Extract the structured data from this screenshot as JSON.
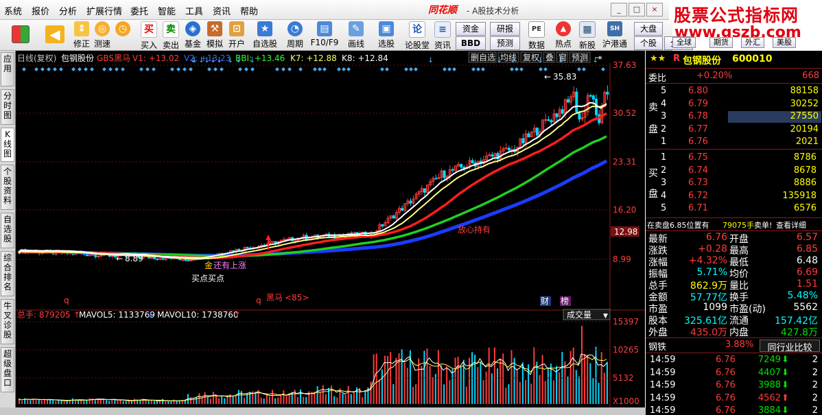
{
  "menu": [
    "系统",
    "报价",
    "分析",
    "扩展行情",
    "委托",
    "智能",
    "工具",
    "资讯",
    "帮助"
  ],
  "app": {
    "logo": "同花顺",
    "title": "- A股技术分析",
    "minimize": "_",
    "maximize": "□",
    "close": "×"
  },
  "watermark": {
    "line1": "股票公式指标网",
    "line2": "www.gszb.com"
  },
  "toolbar": {
    "buttons": [
      {
        "label": "",
        "icon": "layout-icon"
      },
      {
        "label": "",
        "icon": "back-arrow-icon"
      },
      {
        "label": "修正",
        "icon": "up-down-icon"
      },
      {
        "label": "测速",
        "icon": "speed-icon"
      },
      {
        "label": "",
        "icon": "clock-icon"
      },
      {
        "label": "买入",
        "icon": "buy-icon",
        "glyph": "买"
      },
      {
        "label": "卖出",
        "icon": "sell-icon",
        "glyph": "卖"
      },
      {
        "label": "基金",
        "icon": "fund-icon"
      },
      {
        "label": "模拟",
        "icon": "hammer-icon"
      },
      {
        "label": "开户",
        "icon": "lock-icon"
      },
      {
        "label": "自选股",
        "icon": "star-icon"
      },
      {
        "label": "周期",
        "icon": "period-icon"
      },
      {
        "label": "F10/F9",
        "icon": "f10-icon"
      },
      {
        "label": "画线",
        "icon": "pen-icon"
      },
      {
        "label": "选股",
        "icon": "select-icon"
      },
      {
        "label": "论股堂",
        "icon": "discuss-icon",
        "glyph": "论"
      },
      {
        "label": "资讯",
        "icon": "info-icon"
      },
      {
        "label": "数据",
        "icon": "data-icon",
        "glyph": "PE"
      },
      {
        "label": "热点",
        "icon": "hot-icon"
      },
      {
        "label": "新股",
        "icon": "newstock-icon"
      },
      {
        "label": "沪港通",
        "icon": "hk-icon"
      }
    ],
    "boxes": {
      "zijin": "资金",
      "yanbao": "研报",
      "bbd": "BBD",
      "yuce": "预测",
      "dapan": "大盘",
      "gegu": "个股",
      "quanqiu": "全球",
      "qihuo": "期货",
      "waihui": "外汇",
      "meiguo": "美股"
    }
  },
  "lefttabs": [
    "应用",
    "分时图",
    "K线图",
    "个股资料",
    "自选股",
    "综合排名",
    "牛叉诊股",
    "超级盘口"
  ],
  "chart": {
    "header": {
      "period": "日线(复权)",
      "stock": "包钢股份",
      "indicator": "GBS黑马",
      "v1": "V1: +13.02",
      "v2": "V2: +13.23",
      "bbi": "BBI: +13.46",
      "k7": "K7: +12.88",
      "k8": "K8: +12.84"
    },
    "topbuttons": [
      "删自选",
      "均线",
      "复权",
      "叠",
      "窗",
      "预测"
    ],
    "yticks": [
      "37.63",
      "30.52",
      "23.31",
      "16.20",
      "12.98",
      "8.99"
    ],
    "current_price": "12.98",
    "annotations": {
      "high": "35.83",
      "low": "8.89",
      "gold": "金",
      "gold_text": "还有上涨",
      "buy": "买点买点",
      "heima": "黑马",
      "heima_num": "<85>",
      "hold": "放心持有",
      "q": "q",
      "cai": "财",
      "bang": "榜"
    },
    "volume_header": {
      "total": "总手: 879205",
      "mavol5": "MAVOL5: 1133769",
      "mavol10": "MAVOL10: 1738760",
      "select": "成交量"
    },
    "vol_yticks": [
      "15397",
      "10265",
      "5132",
      "X1000"
    ]
  },
  "quote": {
    "stars": "★★",
    "flag": "R",
    "name": "包钢股份",
    "code": "600010",
    "weibi": {
      "label": "委比",
      "pct": "+0.20%",
      "val": "668"
    },
    "sell": [
      {
        "lvl": "5",
        "price": "6.80",
        "vol": "88158"
      },
      {
        "lvl": "4",
        "price": "6.79",
        "vol": "30252"
      },
      {
        "lvl": "3",
        "price": "6.78",
        "vol": "27550"
      },
      {
        "lvl": "2",
        "price": "6.77",
        "vol": "20194"
      },
      {
        "lvl": "1",
        "price": "6.76",
        "vol": "2021"
      }
    ],
    "buy": [
      {
        "lvl": "1",
        "price": "6.75",
        "vol": "8786"
      },
      {
        "lvl": "2",
        "price": "6.74",
        "vol": "8678"
      },
      {
        "lvl": "3",
        "price": "6.73",
        "vol": "8886"
      },
      {
        "lvl": "4",
        "price": "6.72",
        "vol": "135918"
      },
      {
        "lvl": "5",
        "price": "6.71",
        "vol": "6576"
      }
    ],
    "sell_label": [
      "卖",
      "盘"
    ],
    "buy_label": [
      "买",
      "盘"
    ],
    "status": {
      "text": "在卖盘6.85位置有",
      "num": "79075手",
      "action": "卖单!",
      "link": "查看详细"
    },
    "stats": [
      {
        "k1": "最新",
        "v1": "6.76",
        "c1": "red",
        "k2": "开盘",
        "v2": "6.57",
        "c2": "red"
      },
      {
        "k1": "涨跌",
        "v1": "+0.28",
        "c1": "red",
        "k2": "最高",
        "v2": "6.85",
        "c2": "red"
      },
      {
        "k1": "涨幅",
        "v1": "+4.32%",
        "c1": "red",
        "k2": "最低",
        "v2": "6.48",
        "c2": "wht"
      },
      {
        "k1": "振幅",
        "v1": "5.71%",
        "c1": "cyn",
        "k2": "均价",
        "v2": "6.69",
        "c2": "red"
      },
      {
        "k1": "总手",
        "v1": "862.9万",
        "c1": "yel",
        "k2": "量比",
        "v2": "1.51",
        "c2": "red"
      },
      {
        "k1": "金额",
        "v1": "57.77亿",
        "c1": "cyn",
        "k2": "换手",
        "v2": "5.48%",
        "c2": "cyn"
      },
      {
        "k1": "市盈",
        "v1": "1099",
        "c1": "wht",
        "k2": "市盈(动)",
        "v2": "5562",
        "c2": "wht"
      },
      {
        "k1": "股本",
        "v1": "325.61亿",
        "c1": "cyn",
        "k2": "流通",
        "v2": "157.42亿",
        "c2": "cyn"
      },
      {
        "k1": "外盘",
        "v1": "435.0万",
        "c1": "red",
        "k2": "内盘",
        "v2": "427.8万",
        "c2": "grn"
      }
    ],
    "industry": {
      "name": "钢铁",
      "pct": "3.88%",
      "btn": "同行业比较"
    },
    "ticks": [
      {
        "time": "14:59",
        "price": "6.76",
        "vol": "7249",
        "dir": "down",
        "n": "2"
      },
      {
        "time": "14:59",
        "price": "6.76",
        "vol": "4407",
        "dir": "down",
        "n": "2"
      },
      {
        "time": "14:59",
        "price": "6.76",
        "vol": "3988",
        "dir": "down",
        "n": "2"
      },
      {
        "time": "14:59",
        "price": "6.76",
        "vol": "4562",
        "dir": "up",
        "n": "2"
      },
      {
        "time": "14:59",
        "price": "6.76",
        "vol": "3884",
        "dir": "down",
        "n": "2"
      }
    ]
  },
  "colors": {
    "up": "#ff3c3c",
    "down": "#00e000",
    "ma_white": "#ffffff",
    "ma_yellow": "#ffff88",
    "ma_red": "#ff1e1e",
    "ma_green": "#20d020",
    "ma_blue": "#1a3cff",
    "bg": "#000000"
  }
}
